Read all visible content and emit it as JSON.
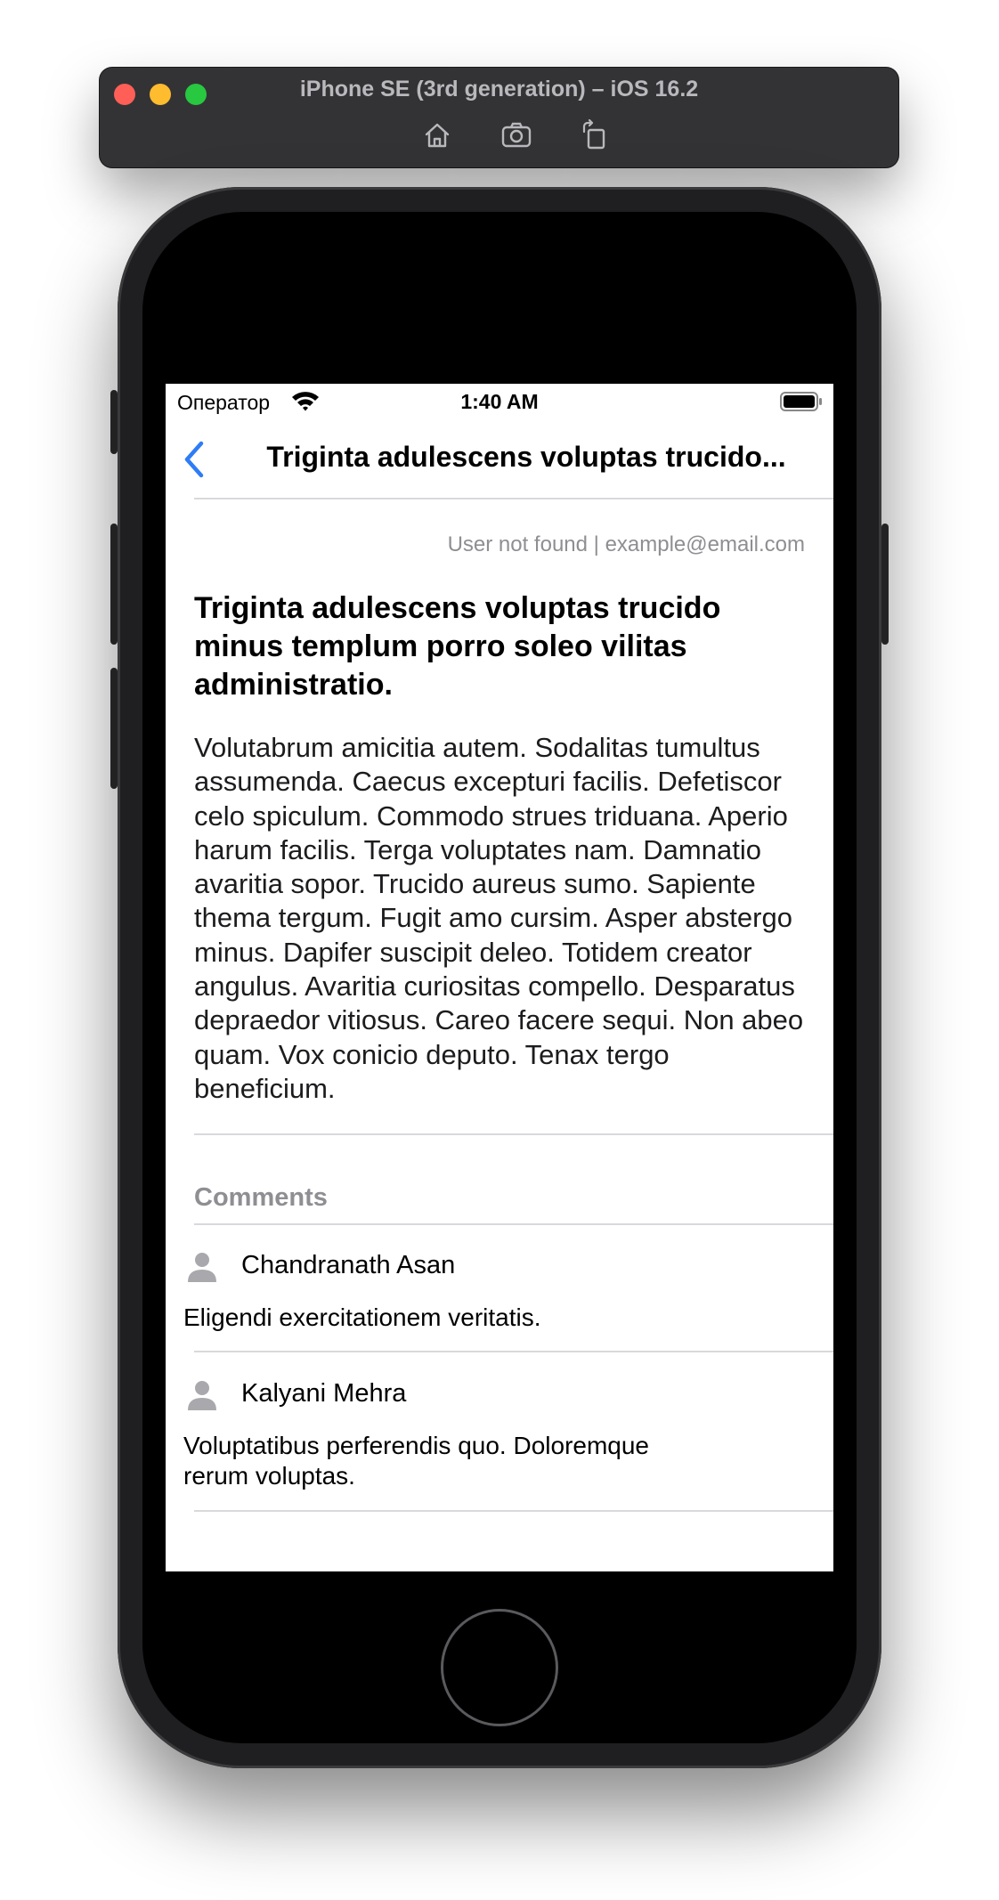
{
  "simulator": {
    "title": "iPhone SE (3rd generation) – iOS 16.2",
    "toolbar": [
      {
        "name": "home-icon"
      },
      {
        "name": "screenshot-icon"
      },
      {
        "name": "rotate-icon"
      }
    ]
  },
  "status_bar": {
    "carrier": "Оператор",
    "time": "1:40 AM"
  },
  "nav": {
    "title": "Triginta adulescens voluptas trucido..."
  },
  "post": {
    "meta": "User not found | example@email.com",
    "title": "Triginta adulescens voluptas trucido minus templum porro soleo vilitas administratio.",
    "body": "Volutabrum amicitia autem. Sodalitas tumultus assumenda. Caecus excepturi facilis. Defetiscor celo spiculum. Commodo strues triduana. Aperio harum facilis. Terga voluptates nam. Damnatio avaritia sopor. Trucido aureus sumo. Sapiente thema tergum. Fugit amo cursim. Asper abstergo minus. Dapifer suscipit deleo. Totidem creator angulus. Avaritia curiositas compello. Desparatus depraedor vitiosus. Careo facere sequi. Non abeo quam. Vox conicio deputo. Tenax tergo beneficium."
  },
  "comments": {
    "header": "Comments",
    "items": [
      {
        "author": "Chandranath Asan",
        "text": "Eligendi exercitationem veritatis."
      },
      {
        "author": "Kalyani Mehra",
        "text": "Voluptatibus perferendis quo. Doloremque rerum voluptas."
      }
    ]
  }
}
